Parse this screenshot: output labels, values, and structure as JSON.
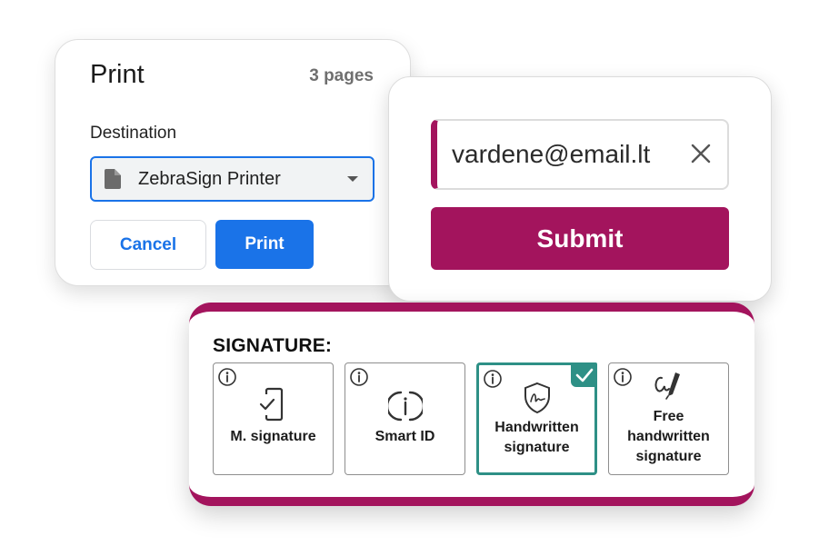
{
  "print_dialog": {
    "title": "Print",
    "pages": "3 pages",
    "destination_label": "Destination",
    "destination_value": "ZebraSign Printer",
    "cancel_label": "Cancel",
    "print_label": "Print",
    "accent_color": "#1a73e8"
  },
  "email_form": {
    "email_value": "vardene@email.lt",
    "submit_label": "Submit",
    "brand_color": "#a3145d"
  },
  "signature": {
    "title": "SIGNATURE:",
    "selected_color": "#2e9086",
    "options": [
      {
        "label": "M. signature",
        "icon": "phone-check-icon",
        "selected": false
      },
      {
        "label": "Smart ID",
        "icon": "smart-id-icon",
        "selected": false
      },
      {
        "label": "Handwritten signature",
        "icon": "shield-signature-icon",
        "selected": true
      },
      {
        "label": "Free handwritten signature",
        "icon": "pen-signature-icon",
        "selected": false
      }
    ]
  }
}
